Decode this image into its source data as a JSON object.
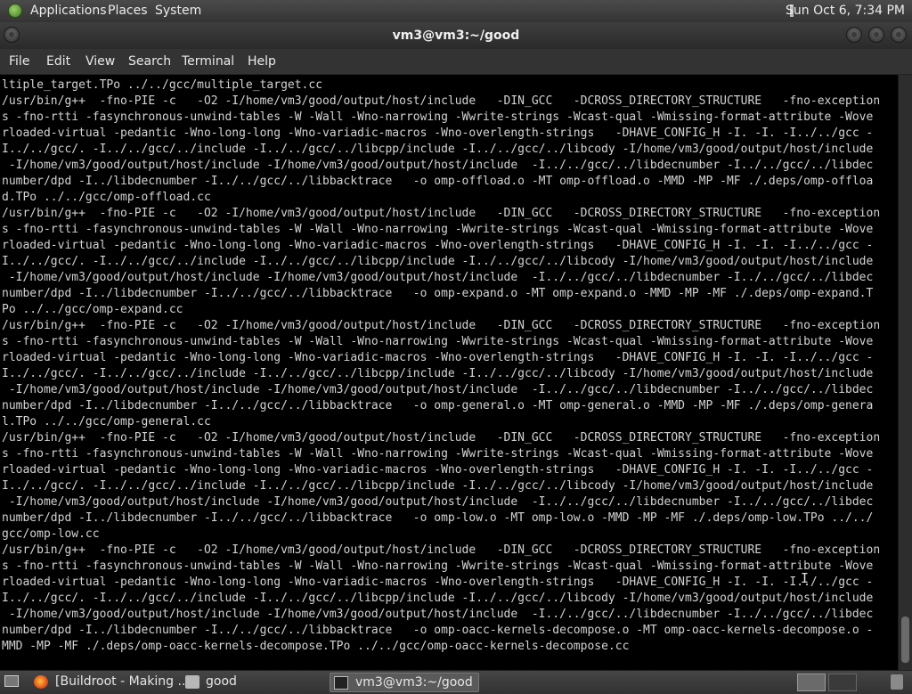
{
  "top_panel": {
    "menus": [
      "Applications",
      "Places",
      "System"
    ],
    "clock": "Sun Oct  6,  7:34 PM"
  },
  "window": {
    "title": "vm3@vm3:~/good"
  },
  "menubar": {
    "items": [
      "File",
      "Edit",
      "View",
      "Search",
      "Terminal",
      "Help"
    ]
  },
  "terminal": {
    "lines": [
      "ltiple_target.TPo ../../gcc/multiple_target.cc",
      "/usr/bin/g++  -fno-PIE -c   -O2 -I/home/vm3/good/output/host/include   -DIN_GCC   -DCROSS_DIRECTORY_STRUCTURE   -fno-exception",
      "s -fno-rtti -fasynchronous-unwind-tables -W -Wall -Wno-narrowing -Wwrite-strings -Wcast-qual -Wmissing-format-attribute -Wove",
      "rloaded-virtual -pedantic -Wno-long-long -Wno-variadic-macros -Wno-overlength-strings   -DHAVE_CONFIG_H -I. -I. -I../../gcc -",
      "I../../gcc/. -I../../gcc/../include -I../../gcc/../libcpp/include -I../../gcc/../libcody -I/home/vm3/good/output/host/include",
      " -I/home/vm3/good/output/host/include -I/home/vm3/good/output/host/include  -I../../gcc/../libdecnumber -I../../gcc/../libdec",
      "number/dpd -I../libdecnumber -I../../gcc/../libbacktrace   -o omp-offload.o -MT omp-offload.o -MMD -MP -MF ./.deps/omp-offloa",
      "d.TPo ../../gcc/omp-offload.cc",
      "/usr/bin/g++  -fno-PIE -c   -O2 -I/home/vm3/good/output/host/include   -DIN_GCC   -DCROSS_DIRECTORY_STRUCTURE   -fno-exception",
      "s -fno-rtti -fasynchronous-unwind-tables -W -Wall -Wno-narrowing -Wwrite-strings -Wcast-qual -Wmissing-format-attribute -Wove",
      "rloaded-virtual -pedantic -Wno-long-long -Wno-variadic-macros -Wno-overlength-strings   -DHAVE_CONFIG_H -I. -I. -I../../gcc -",
      "I../../gcc/. -I../../gcc/../include -I../../gcc/../libcpp/include -I../../gcc/../libcody -I/home/vm3/good/output/host/include",
      " -I/home/vm3/good/output/host/include -I/home/vm3/good/output/host/include  -I../../gcc/../libdecnumber -I../../gcc/../libdec",
      "number/dpd -I../libdecnumber -I../../gcc/../libbacktrace   -o omp-expand.o -MT omp-expand.o -MMD -MP -MF ./.deps/omp-expand.T",
      "Po ../../gcc/omp-expand.cc",
      "/usr/bin/g++  -fno-PIE -c   -O2 -I/home/vm3/good/output/host/include   -DIN_GCC   -DCROSS_DIRECTORY_STRUCTURE   -fno-exception",
      "s -fno-rtti -fasynchronous-unwind-tables -W -Wall -Wno-narrowing -Wwrite-strings -Wcast-qual -Wmissing-format-attribute -Wove",
      "rloaded-virtual -pedantic -Wno-long-long -Wno-variadic-macros -Wno-overlength-strings   -DHAVE_CONFIG_H -I. -I. -I../../gcc -",
      "I../../gcc/. -I../../gcc/../include -I../../gcc/../libcpp/include -I../../gcc/../libcody -I/home/vm3/good/output/host/include",
      " -I/home/vm3/good/output/host/include -I/home/vm3/good/output/host/include  -I../../gcc/../libdecnumber -I../../gcc/../libdec",
      "number/dpd -I../libdecnumber -I../../gcc/../libbacktrace   -o omp-general.o -MT omp-general.o -MMD -MP -MF ./.deps/omp-genera",
      "l.TPo ../../gcc/omp-general.cc",
      "/usr/bin/g++  -fno-PIE -c   -O2 -I/home/vm3/good/output/host/include   -DIN_GCC   -DCROSS_DIRECTORY_STRUCTURE   -fno-exception",
      "s -fno-rtti -fasynchronous-unwind-tables -W -Wall -Wno-narrowing -Wwrite-strings -Wcast-qual -Wmissing-format-attribute -Wove",
      "rloaded-virtual -pedantic -Wno-long-long -Wno-variadic-macros -Wno-overlength-strings   -DHAVE_CONFIG_H -I. -I. -I../../gcc -",
      "I../../gcc/. -I../../gcc/../include -I../../gcc/../libcpp/include -I../../gcc/../libcody -I/home/vm3/good/output/host/include",
      " -I/home/vm3/good/output/host/include -I/home/vm3/good/output/host/include  -I../../gcc/../libdecnumber -I../../gcc/../libdec",
      "number/dpd -I../libdecnumber -I../../gcc/../libbacktrace   -o omp-low.o -MT omp-low.o -MMD -MP -MF ./.deps/omp-low.TPo ../../",
      "gcc/omp-low.cc",
      "/usr/bin/g++  -fno-PIE -c   -O2 -I/home/vm3/good/output/host/include   -DIN_GCC   -DCROSS_DIRECTORY_STRUCTURE   -fno-exception",
      "s -fno-rtti -fasynchronous-unwind-tables -W -Wall -Wno-narrowing -Wwrite-strings -Wcast-qual -Wmissing-format-attribute -Wove",
      "rloaded-virtual -pedantic -Wno-long-long -Wno-variadic-macros -Wno-overlength-strings   -DHAVE_CONFIG_H -I. -I. -I../../gcc -",
      "I../../gcc/. -I../../gcc/../include -I../../gcc/../libcpp/include -I../../gcc/../libcody -I/home/vm3/good/output/host/include",
      " -I/home/vm3/good/output/host/include -I/home/vm3/good/output/host/include  -I../../gcc/../libdecnumber -I../../gcc/../libdec",
      "number/dpd -I../libdecnumber -I../../gcc/../libbacktrace   -o omp-oacc-kernels-decompose.o -MT omp-oacc-kernels-decompose.o -",
      "MMD -MP -MF ./.deps/omp-oacc-kernels-decompose.TPo ../../gcc/omp-oacc-kernels-decompose.cc"
    ]
  },
  "taskbar": {
    "tasks": [
      {
        "label": "[Buildroot - Making ...",
        "icon": "firefox-icon"
      },
      {
        "label": "good",
        "icon": "folder-icon"
      },
      {
        "label": "vm3@vm3:~/good",
        "icon": "terminal-icon"
      }
    ]
  }
}
